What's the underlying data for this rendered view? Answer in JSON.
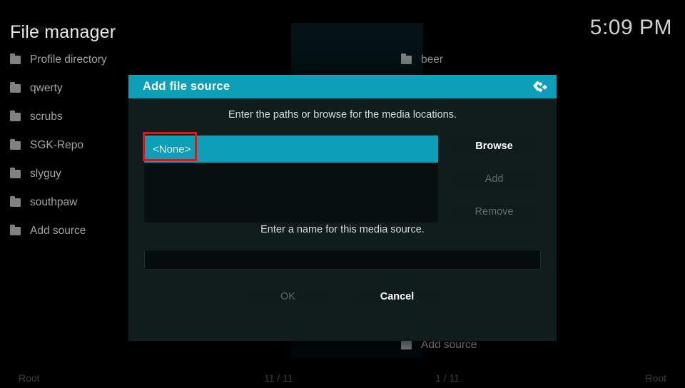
{
  "screen": {
    "title": "File manager",
    "title_ghost": "Display",
    "clock": "5:09 PM"
  },
  "colors": {
    "accent": "#0d9fb8",
    "dialog_bg": "#111c1c",
    "listbox_bg": "#070f0f",
    "annotation": "#ef1111",
    "text": "#cfd3d3",
    "text_dim": "#626a6a"
  },
  "left_panel": {
    "items": [
      {
        "label": "Profile directory",
        "icon": "folder-icon"
      },
      {
        "label": "qwerty",
        "icon": "folder-icon"
      },
      {
        "label": "scrubs",
        "icon": "folder-icon"
      },
      {
        "label": "SGK-Repo",
        "icon": "folder-icon"
      },
      {
        "label": "slyguy",
        "icon": "folder-icon"
      },
      {
        "label": "southpaw",
        "icon": "folder-icon"
      },
      {
        "label": "Add source",
        "icon": "folder-icon"
      }
    ]
  },
  "right_panel": {
    "items": [
      {
        "label": "beer",
        "icon": "folder-icon"
      },
      {
        "label": "Add source",
        "icon": "folder-icon"
      }
    ]
  },
  "status_bar": {
    "left": "Root",
    "mid_left": "11 / 11",
    "mid_right": "1 / 11",
    "right": "Root"
  },
  "dialog": {
    "title": "Add file source",
    "logo_icon": "kodi-logo-icon",
    "hint_paths": "Enter the paths or browse for the media locations.",
    "hint_name": "Enter a name for this media source.",
    "path_value": "<None>",
    "name_value": "",
    "name_placeholder": "",
    "side_buttons": [
      {
        "label": "Browse",
        "enabled": true
      },
      {
        "label": "Add",
        "enabled": false
      },
      {
        "label": "Remove",
        "enabled": false
      }
    ],
    "footer_buttons": [
      {
        "label": "OK",
        "enabled": false
      },
      {
        "label": "Cancel",
        "enabled": true
      }
    ]
  }
}
